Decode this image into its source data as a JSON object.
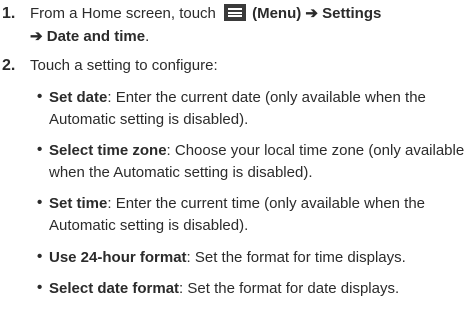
{
  "steps": [
    {
      "number": "1.",
      "text_before": "From a Home screen, touch",
      "menu_label": "(Menu)",
      "arrow1": "➔",
      "settings": "Settings",
      "arrow2": "➔",
      "date_and_time": "Date and time",
      "end": "."
    },
    {
      "number": "2.",
      "text": "Touch a setting to configure:"
    }
  ],
  "bullets": [
    {
      "term": "Set date",
      "line1": ": Enter the current date (only available when the",
      "line2": "Automatic setting is disabled)."
    },
    {
      "term": "Select time zone",
      "line1": ": Choose your local time zone (only available",
      "line2": "when the Automatic setting is disabled)."
    },
    {
      "term": "Set time",
      "line1": ": Enter the current time (only available when the",
      "line2": "Automatic setting is disabled)."
    },
    {
      "term": "Use 24-hour format",
      "line1": ": Set the format for time displays."
    },
    {
      "term": "Select date format",
      "line1": ": Set the format for date displays."
    }
  ],
  "icons": {
    "menu": "menu-icon",
    "bullet": "•"
  }
}
